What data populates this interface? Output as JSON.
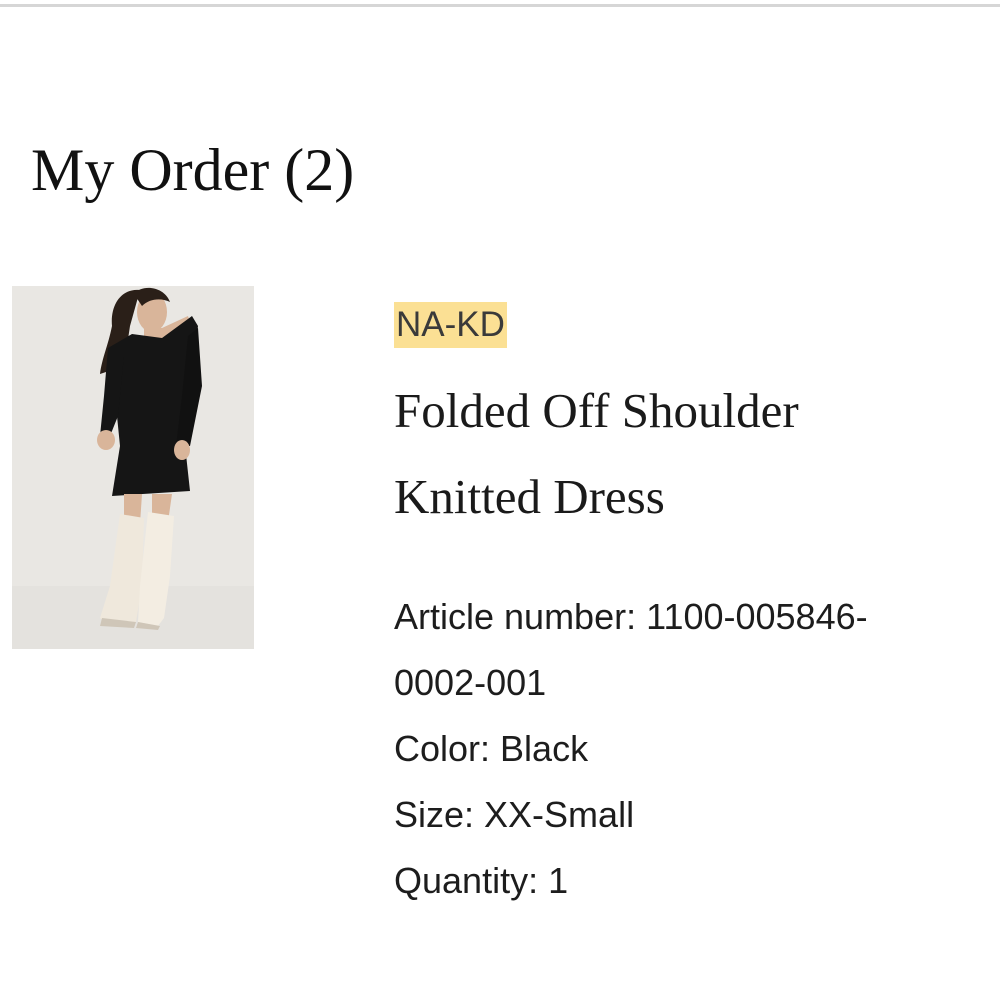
{
  "header": {
    "title": "My Order (2)"
  },
  "order_item": {
    "image_alt": "Model wearing black folded off-shoulder knitted dress with cream knee-high boots",
    "brand": "NA-KD",
    "name_line1": "Folded Off Shoulder",
    "name_line2": "Knitted Dress",
    "article_number_line1": "Article number: 1100-005846-",
    "article_number_line2": "0002-001",
    "color": "Color: Black",
    "size": "Size: XX-Small",
    "quantity": "Quantity: 1"
  },
  "colors": {
    "brand_highlight": "#fbe094",
    "divider": "#d6d6d6",
    "text": "#1a1a1a"
  }
}
